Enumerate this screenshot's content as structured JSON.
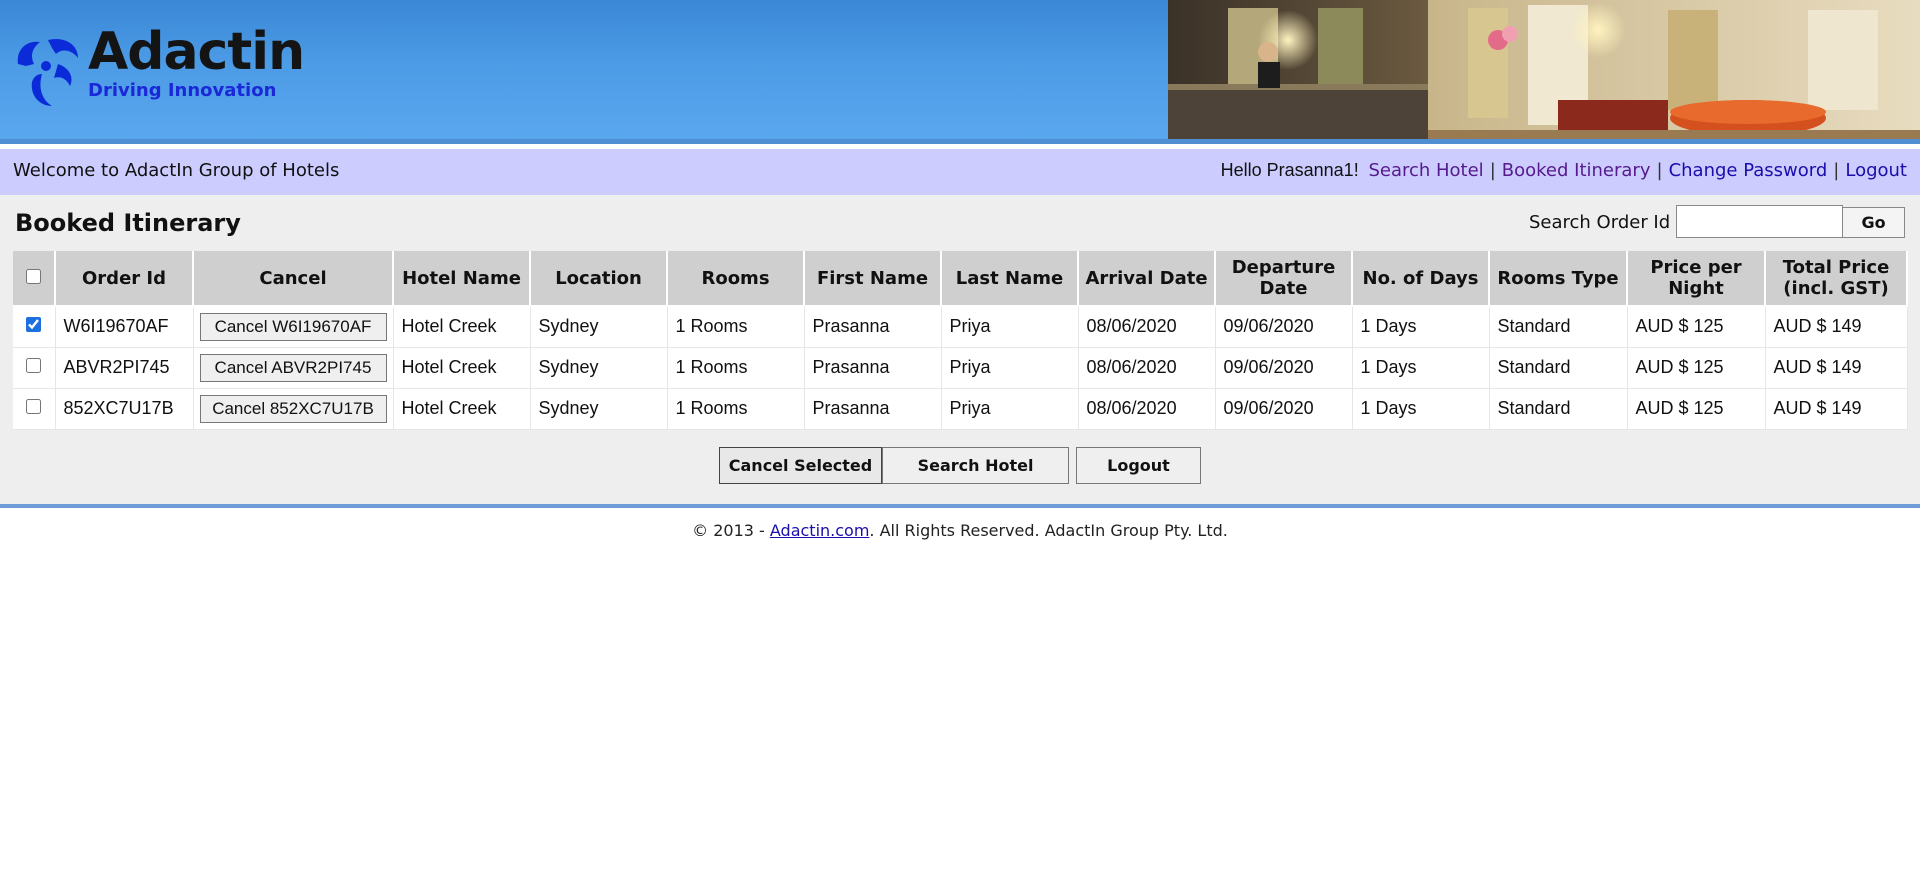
{
  "brand": {
    "name": "Adactin",
    "tagline": "Driving Innovation",
    "accent_color": "#1a28d8"
  },
  "welcome": {
    "text": "Welcome to AdactIn Group of Hotels",
    "greeting": "Hello Prasanna1!",
    "links": {
      "search_hotel": "Search Hotel",
      "booked_itinerary": "Booked Itinerary",
      "change_password": "Change Password",
      "logout": "Logout"
    },
    "separator": "|"
  },
  "page": {
    "title": "Booked Itinerary",
    "search_label": "Search Order Id",
    "search_value": "",
    "go_label": "Go"
  },
  "table": {
    "headers": [
      "",
      "Order Id",
      "Cancel",
      "Hotel Name",
      "Location",
      "Rooms",
      "First Name",
      "Last Name",
      "Arrival Date",
      "Departure Date",
      "No. of Days",
      "Rooms Type",
      "Price per Night",
      "Total Price (incl. GST)"
    ],
    "rows": [
      {
        "checked": true,
        "order_id": "W6I19670AF",
        "cancel_label": "Cancel W6I19670AF",
        "hotel": "Hotel Creek",
        "location": "Sydney",
        "rooms": "1 Rooms",
        "first_name": "Prasanna",
        "last_name": "Priya",
        "arrival": "08/06/2020",
        "departure": "09/06/2020",
        "days": "1 Days",
        "room_type": "Standard",
        "price_per_night": "AUD $ 125",
        "total_price": "AUD $ 149"
      },
      {
        "checked": false,
        "order_id": "ABVR2PI745",
        "cancel_label": "Cancel ABVR2PI745",
        "hotel": "Hotel Creek",
        "location": "Sydney",
        "rooms": "1 Rooms",
        "first_name": "Prasanna",
        "last_name": "Priya",
        "arrival": "08/06/2020",
        "departure": "09/06/2020",
        "days": "1 Days",
        "room_type": "Standard",
        "price_per_night": "AUD $ 125",
        "total_price": "AUD $ 149"
      },
      {
        "checked": false,
        "order_id": "852XC7U17B",
        "cancel_label": "Cancel 852XC7U17B",
        "hotel": "Hotel Creek",
        "location": "Sydney",
        "rooms": "1 Rooms",
        "first_name": "Prasanna",
        "last_name": "Priya",
        "arrival": "08/06/2020",
        "departure": "09/06/2020",
        "days": "1 Days",
        "room_type": "Standard",
        "price_per_night": "AUD $ 125",
        "total_price": "AUD $ 149"
      }
    ]
  },
  "actions": {
    "cancel_selected": "Cancel Selected",
    "search_hotel": "Search Hotel",
    "logout": "Logout"
  },
  "footer": {
    "prefix": "© 2013 - ",
    "link_text": "Adactin.com",
    "suffix": ". All Rights Reserved. AdactIn Group Pty. Ltd."
  }
}
